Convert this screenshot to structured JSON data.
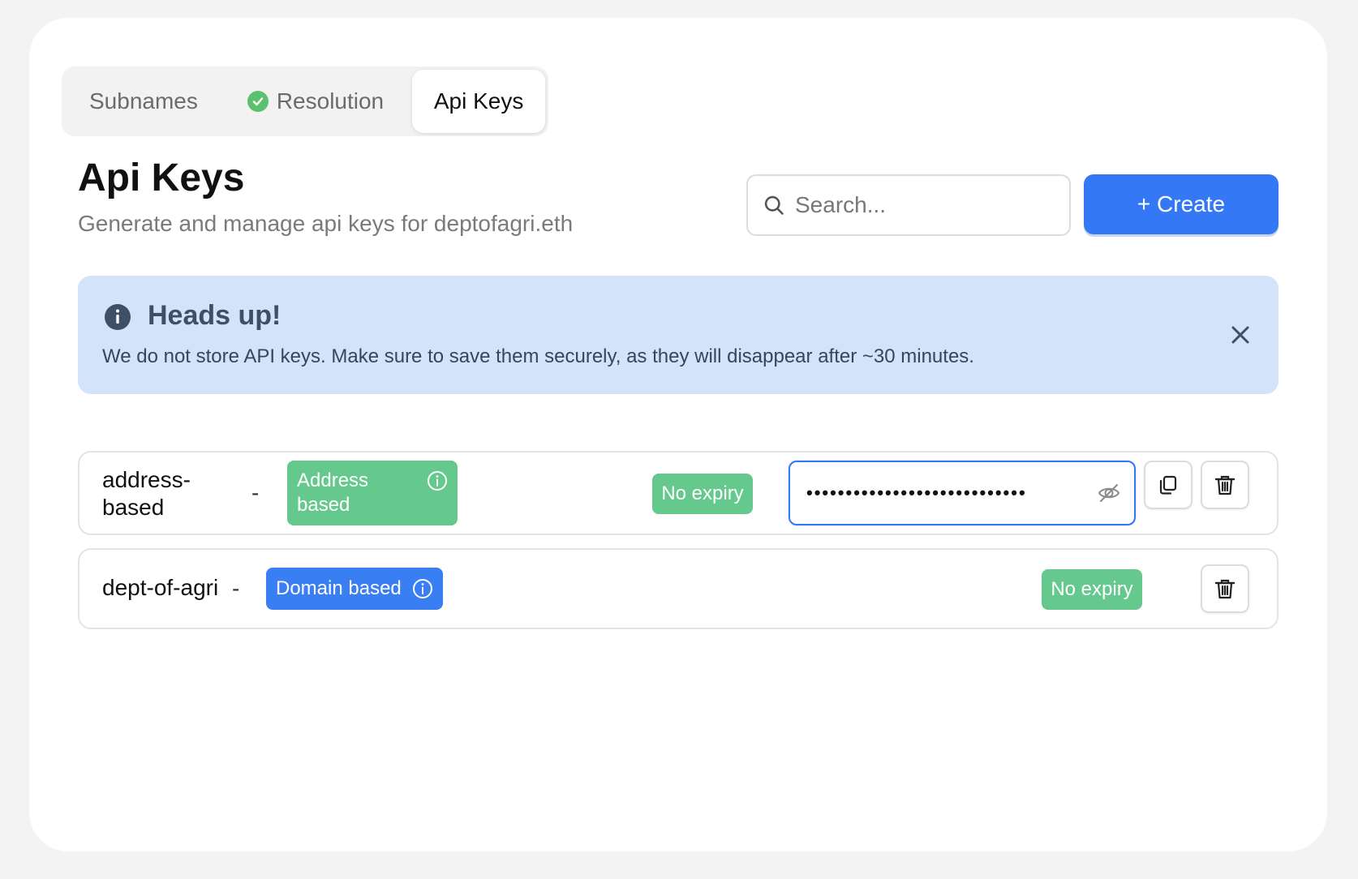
{
  "tabs": [
    {
      "label": "Subnames",
      "active": false
    },
    {
      "label": "Resolution",
      "active": false,
      "icon": "check-circle-icon"
    },
    {
      "label": "Api Keys",
      "active": true
    }
  ],
  "header": {
    "title": "Api Keys",
    "subtitle": "Generate and manage api keys for deptofagri.eth"
  },
  "search": {
    "placeholder": "Search...",
    "value": ""
  },
  "create_button": {
    "label": "+ Create"
  },
  "alert": {
    "heading": "Heads up!",
    "message": "We do not store API keys. Make sure to save them securely, as they will disappear after ~30 minutes."
  },
  "keys": [
    {
      "name_line1": "address-",
      "name_line2": "based",
      "separator": "-",
      "type_line1": "Address",
      "type_line2": "based",
      "expiry": "No expiry",
      "secret_mask": "••••••••••••••••••••••••••••"
    },
    {
      "name": "dept-of-agri",
      "separator": "-",
      "type": "Domain based",
      "expiry": "No expiry"
    }
  ],
  "colors": {
    "primary": "#3478f6",
    "success": "#65c98e",
    "alert_bg": "#d3e3fa",
    "check": "#5cc16e"
  }
}
